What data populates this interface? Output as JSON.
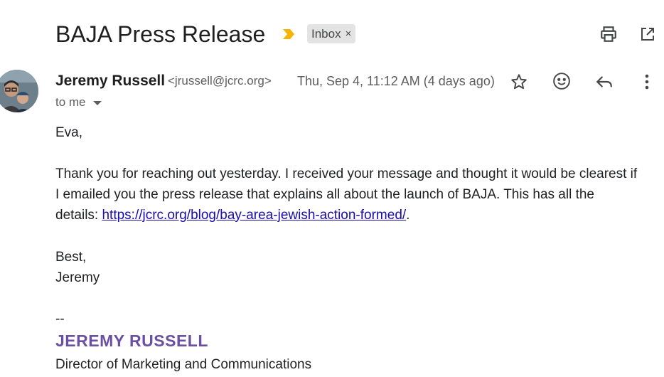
{
  "email": {
    "subject": "BAJA Press Release",
    "label_chip": "Inbox",
    "chip_close": "×",
    "sender": {
      "name": "Jeremy Russell",
      "email": "<jrussell@jcrc.org>"
    },
    "date": "Thu, Sep 4, 11:12 AM (4 days ago)",
    "recipient": "to me",
    "body": {
      "greeting": "Eva,",
      "para_line1": "Thank you for reaching out yesterday. I received your message and thought it would be clearest if",
      "para_line2": "I emailed you the press release that explains all about the launch of BAJA. This has all the",
      "para_line3_prefix": "details: ",
      "link": "https://jcrc.org/blog/bay-area-jewish-action-formed/",
      "para_line3_suffix": ".",
      "closing": "Best,",
      "signoff": "Jeremy",
      "sig_dash": "--",
      "sig_name": "JEREMY RUSSELL",
      "sig_title": "Director of Marketing and Communications"
    }
  },
  "icons": {
    "importance": "importance-marker-icon",
    "print": "print-icon",
    "open_new_window": "open-in-new-window-icon",
    "star": "star-icon",
    "emoji": "emoji-reaction-icon",
    "reply": "reply-icon",
    "more": "more-vert-icon"
  },
  "colors": {
    "importance": "#f4b400",
    "chip_bg": "#e3e3e3",
    "link": "#1a0dab",
    "signature": "#6b4fa3"
  }
}
